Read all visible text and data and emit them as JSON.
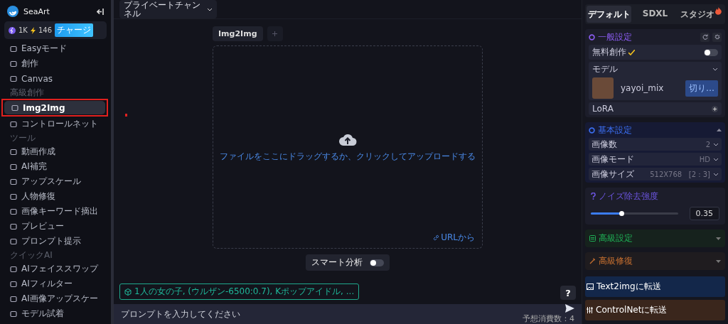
{
  "brand": {
    "name": "SeaArt"
  },
  "credits": {
    "energy": "1K",
    "power": "146",
    "charge_button": "チャージ"
  },
  "sidebar": [
    {
      "kind": "item",
      "label": "Easyモード",
      "selected": false,
      "highlighted": false
    },
    {
      "kind": "item",
      "label": "創作",
      "selected": false,
      "highlighted": false
    },
    {
      "kind": "item",
      "label": "Canvas",
      "selected": false,
      "highlighted": false
    },
    {
      "kind": "section",
      "label": "高級創作"
    },
    {
      "kind": "item",
      "label": "Img2Img",
      "selected": true,
      "highlighted": true
    },
    {
      "kind": "item",
      "label": "コントロールネット",
      "selected": false,
      "highlighted": false
    },
    {
      "kind": "section",
      "label": "ツール"
    },
    {
      "kind": "item",
      "label": "動画作成",
      "selected": false,
      "highlighted": false
    },
    {
      "kind": "item",
      "label": "AI補完",
      "selected": false,
      "highlighted": false
    },
    {
      "kind": "item",
      "label": "アップスケール",
      "selected": false,
      "highlighted": false
    },
    {
      "kind": "item",
      "label": "人物修復",
      "selected": false,
      "highlighted": false
    },
    {
      "kind": "item",
      "label": "画像キーワード摘出",
      "selected": false,
      "highlighted": false
    },
    {
      "kind": "item",
      "label": "プレビュー",
      "selected": false,
      "highlighted": false
    },
    {
      "kind": "item",
      "label": "プロンプト提示",
      "selected": false,
      "highlighted": false
    },
    {
      "kind": "section",
      "label": "クイックAI"
    },
    {
      "kind": "item",
      "label": "AIフェイススワップ",
      "selected": false,
      "highlighted": false
    },
    {
      "kind": "item",
      "label": "AIフィルター",
      "selected": false,
      "highlighted": false
    },
    {
      "kind": "item",
      "label": "AI画像アップスケー",
      "selected": false,
      "highlighted": false
    },
    {
      "kind": "item",
      "label": "モデル試着",
      "selected": false,
      "highlighted": false
    }
  ],
  "channel_dropdown": {
    "label": "プライベートチャンネル"
  },
  "workspace_tabs": [
    {
      "label": "Img2Img",
      "selected": true
    }
  ],
  "upload": {
    "hint": "ファイルをここにドラッグするか、クリックしてアップロードする",
    "url_link": "URLから"
  },
  "smart_analysis": {
    "label": "スマート分析",
    "on": false
  },
  "prompt_chip": "1人の女の子, (ウルザン-6500:0.7), Kポップアイドル, ...",
  "help_button": "?",
  "prompt": {
    "placeholder": "プロンプトを入力してください",
    "cost": "予想消費数：4"
  },
  "settings_tabs": [
    {
      "label": "デフォルト",
      "selected": true,
      "hot": false
    },
    {
      "label": "SDXL",
      "selected": false,
      "hot": false
    },
    {
      "label": "スタジオ",
      "selected": false,
      "hot": true
    }
  ],
  "general": {
    "title": "一般設定",
    "free_label": "無料創作",
    "free_on": false,
    "model_label": "モデル",
    "model_name": "yayoi_mix",
    "switch_button": "切り…",
    "lora_label": "LoRA"
  },
  "basic": {
    "title": "基本設定",
    "rows": [
      {
        "label": "画像数",
        "value": "2"
      },
      {
        "label": "画像モード",
        "value": "HD"
      },
      {
        "label": "画像サイズ",
        "value": "512X768   [2 : 3]"
      }
    ]
  },
  "noise": {
    "title": "ノイズ除去強度",
    "level": 0.35,
    "reading": "0.35"
  },
  "advanced": {
    "title": "高級設定"
  },
  "repair": {
    "title": "高級修復"
  },
  "actions": [
    {
      "label": "Text2imgに転送",
      "kind": "text2img"
    },
    {
      "label": "ControlNetに転送",
      "kind": "controlnet"
    }
  ]
}
